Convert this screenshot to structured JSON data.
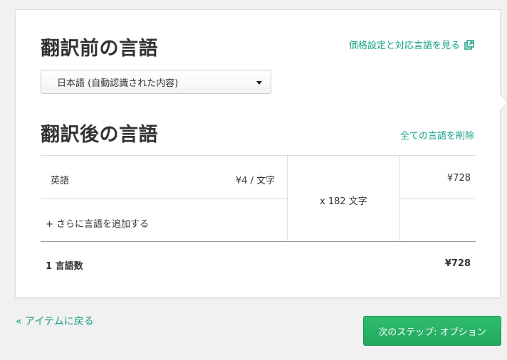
{
  "source": {
    "heading": "翻訳前の言語",
    "pricing_link": "価格設定と対応言語を見る",
    "pricing_icon": "external-link-icon",
    "select_value": "日本語 (自動認識された内容)"
  },
  "target": {
    "heading": "翻訳後の言語",
    "remove_all_link": "全ての言語を削除",
    "languages": [
      {
        "name": "英語",
        "rate": "¥4 / 文字",
        "price": "¥728"
      }
    ],
    "char_count": "x 182 文字",
    "add_language_link": "+ さらに言語を追加する",
    "total_label": "1 言語数",
    "total_price": "¥728"
  },
  "footer": {
    "back_link": "« アイテムに戻る",
    "next_button": "次のステップ: オプション"
  },
  "colors": {
    "accent": "#16a085",
    "button": "#27ae60"
  }
}
